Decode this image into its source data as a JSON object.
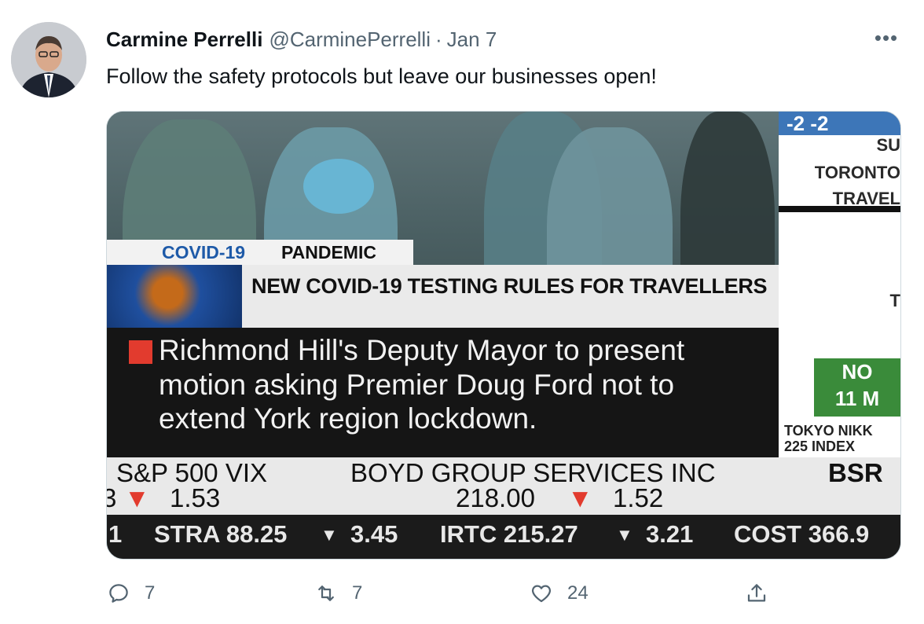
{
  "tweet": {
    "author_name": "Carmine Perrelli",
    "handle": "@CarminePerrelli",
    "separator": "·",
    "date": "Jan 7",
    "text": "Follow the safety protocols but leave our businesses open!"
  },
  "media": {
    "top_right": {
      "blue": "-2  -2",
      "sun": "SU",
      "city": "TORONTO",
      "travel": "TRAVEL",
      "t": "T",
      "green_line1": "NO",
      "green_line2": "11 M",
      "nikkei_line1": "TOKYO NIKK",
      "nikkei_line2": "225 INDEX"
    },
    "covid_tag_blue": "COVID-19",
    "covid_tag_black": "PANDEMIC",
    "headline": "NEW COVID-19 TESTING RULES FOR TRAVELLERS",
    "body_lines": [
      "Richmond Hill's Deputy Mayor to present",
      "motion asking Premier Doug Ford not to",
      "extend York region lockdown."
    ],
    "ticker1": {
      "left_label": "S&P 500 VIX",
      "left_prefix": "3",
      "left_change": "1.53",
      "mid_label": "BOYD GROUP SERVICES INC",
      "mid_value": "218.00",
      "mid_change": "1.52",
      "right_label": "BSR"
    },
    "ticker2": {
      "lead": "1",
      "item1": "STRA 88.25",
      "change1": "3.45",
      "item2": "IRTC 215.27",
      "change2": "3.21",
      "item3": "COST 366.9"
    },
    "down_arrow_glyph": "▼"
  },
  "actions": {
    "reply_count": "7",
    "retweet_count": "7",
    "like_count": "24"
  },
  "more_glyph": "•••"
}
